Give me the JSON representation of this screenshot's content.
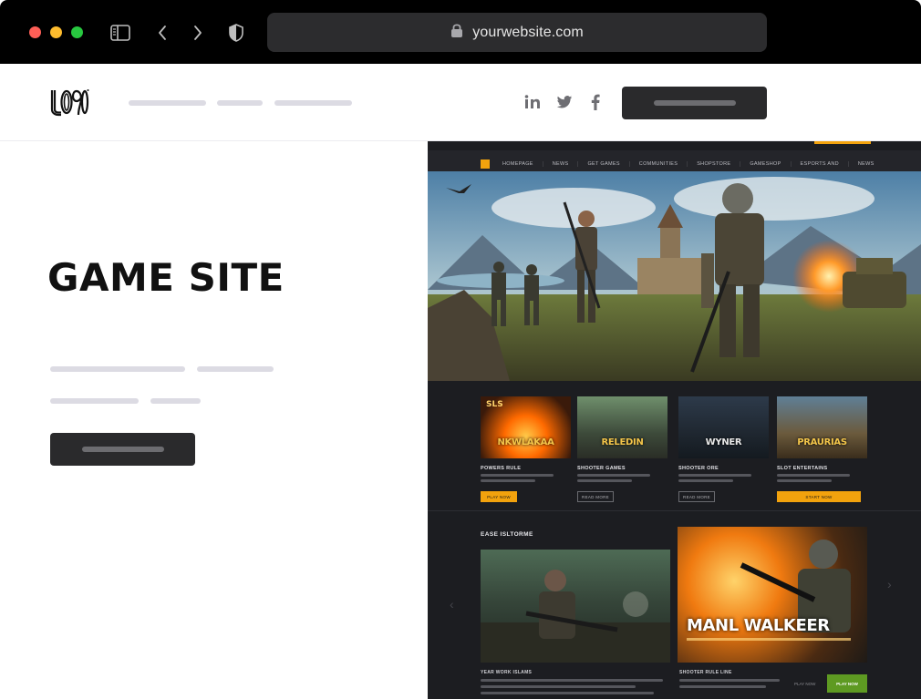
{
  "browser": {
    "url": "yourwebsite.com"
  },
  "site": {
    "logo_text": "L090"
  },
  "hero": {
    "title": "GAME SITE"
  },
  "mock": {
    "nav": [
      "HOMEPAGE",
      "NEWS",
      "GET GAMES",
      "COMMUNITIES",
      "SHOPSTORE",
      "GAMESHOP",
      "ESPORTS AND",
      "NEWS",
      "PLAYERS"
    ],
    "cards": [
      {
        "art_title": "NKWLAKAA",
        "corner": "SLS",
        "title": "POWERS RULE",
        "button": "PLAY NOW"
      },
      {
        "art_title": "RELEDIN",
        "corner": "",
        "title": "SHOOTER GAMES",
        "button": "READ MORE"
      },
      {
        "art_title": "WYNER",
        "corner": "",
        "title": "SHOOTER ORE",
        "button": "READ MORE"
      },
      {
        "art_title": "PRAURIAS",
        "corner": "",
        "title": "SLOT ENTERTAINS",
        "button": "START NOW"
      }
    ],
    "section_label": "EASE ISLTORME",
    "feature_right_title": "MANL WALKEER",
    "feature_left_caption": "YEAR WORK ISLAMS",
    "feature_right_caption": "SHOOTER RULE LINE",
    "play_label": "PLAY NOW",
    "play_button": "PLAY NOW"
  },
  "colors": {
    "accent": "#f2a20d",
    "chrome": "#000000",
    "button_dark": "#2a2a2c",
    "placeholder_line": "#dcdbe3",
    "play_green": "#5e9a22"
  }
}
